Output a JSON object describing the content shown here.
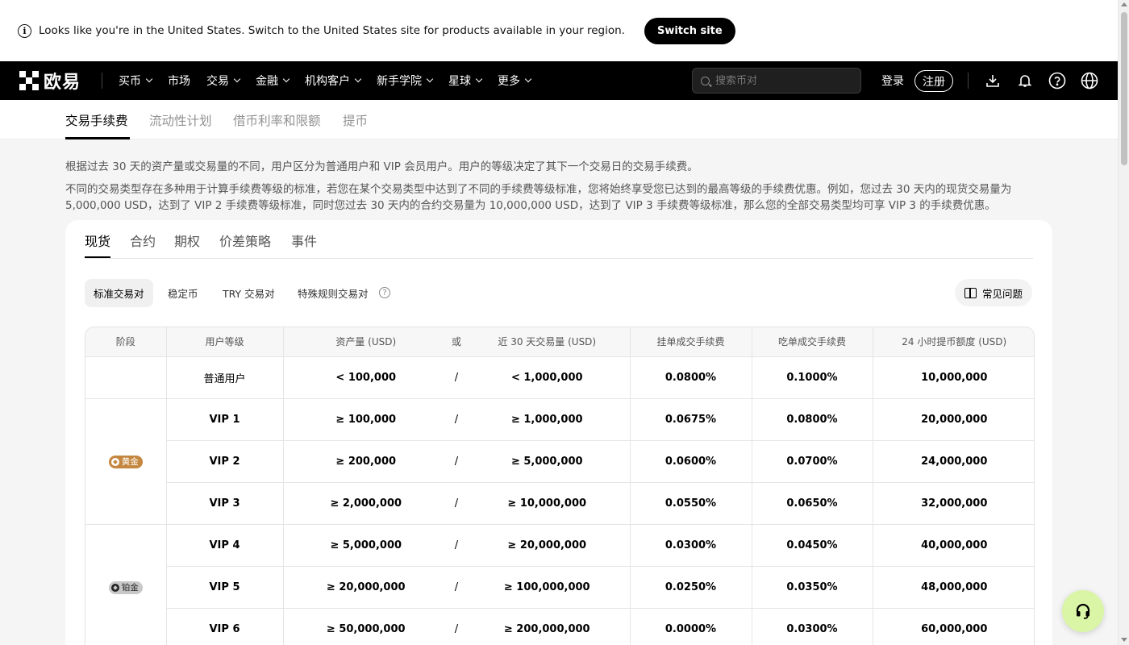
{
  "banner": {
    "text": "Looks like you're in the United States. Switch to the United States site for products available in your region.",
    "switch_label": "Switch site"
  },
  "nav": {
    "logo_text": "欧易",
    "items": [
      {
        "label": "买币",
        "dropdown": true
      },
      {
        "label": "市场",
        "dropdown": false
      },
      {
        "label": "交易",
        "dropdown": true
      },
      {
        "label": "金融",
        "dropdown": true
      },
      {
        "label": "机构客户",
        "dropdown": true
      },
      {
        "label": "新手学院",
        "dropdown": true
      },
      {
        "label": "星球",
        "dropdown": true
      },
      {
        "label": "更多",
        "dropdown": true
      }
    ],
    "search_placeholder": "搜索币对",
    "login_label": "登录",
    "register_label": "注册"
  },
  "page_tabs": [
    "交易手续费",
    "流动性计划",
    "借币利率和限额",
    "提币"
  ],
  "description": {
    "line1": "根据过去 30 天的资产量或交易量的不同，用户区分为普通用户和 VIP 会员用户。用户的等级决定了其下一个交易日的交易手续费。",
    "line2": "不同的交易类型存在多种用于计算手续费等级的标准，若您在某个交易类型中达到了不同的手续费等级标准，您将始终享受您已达到的最高等级的手续费优惠。例如，您过去 30 天内的现货交易量为 5,000,000 USD，达到了 VIP 2 手续费等级标准，同时您过去 30 天内的合约交易量为 10,000,000 USD，达到了 VIP 3 手续费等级标准，那么您的全部交易类型均可享 VIP 3 的手续费优惠。"
  },
  "card_tabs": [
    "现货",
    "合约",
    "期权",
    "价差策略",
    "事件"
  ],
  "sub_tabs": [
    "标准交易对",
    "稳定币",
    "TRY 交易对",
    "特殊规则交易对"
  ],
  "faq_label": "常见问题",
  "table": {
    "headers": {
      "stage": "阶段",
      "level": "用户等级",
      "assets": "资产量 (USD)",
      "or": "或",
      "volume": "近 30 天交易量 (USD)",
      "maker": "挂单成交手续费",
      "taker": "吃单成交手续费",
      "withdraw": "24 小时提币额度 (USD)"
    },
    "tiers": {
      "gold": "黄金",
      "platinum": "铂金"
    },
    "rows": [
      {
        "level": "普通用户",
        "assets": "< 100,000",
        "or": "/",
        "volume": "< 1,000,000",
        "maker": "0.0800%",
        "taker": "0.1000%",
        "withdraw": "10,000,000"
      },
      {
        "level": "VIP 1",
        "assets": "≥ 100,000",
        "or": "/",
        "volume": "≥ 1,000,000",
        "maker": "0.0675%",
        "taker": "0.0800%",
        "withdraw": "20,000,000"
      },
      {
        "level": "VIP 2",
        "assets": "≥ 200,000",
        "or": "/",
        "volume": "≥ 5,000,000",
        "maker": "0.0600%",
        "taker": "0.0700%",
        "withdraw": "24,000,000"
      },
      {
        "level": "VIP 3",
        "assets": "≥ 2,000,000",
        "or": "/",
        "volume": "≥ 10,000,000",
        "maker": "0.0550%",
        "taker": "0.0650%",
        "withdraw": "32,000,000"
      },
      {
        "level": "VIP 4",
        "assets": "≥ 5,000,000",
        "or": "/",
        "volume": "≥ 20,000,000",
        "maker": "0.0300%",
        "taker": "0.0450%",
        "withdraw": "40,000,000"
      },
      {
        "level": "VIP 5",
        "assets": "≥ 20,000,000",
        "or": "/",
        "volume": "≥ 100,000,000",
        "maker": "0.0250%",
        "taker": "0.0350%",
        "withdraw": "48,000,000"
      },
      {
        "level": "VIP 6",
        "assets": "≥ 50,000,000",
        "or": "/",
        "volume": "≥ 200,000,000",
        "maker": "0.0000%",
        "taker": "0.0300%",
        "withdraw": "60,000,000"
      }
    ]
  },
  "colors": {
    "nav_bg": "#000000",
    "gold_badge": "#c5873f",
    "platinum_badge": "#c8c8c8",
    "support_button": "#d9f5a5"
  }
}
